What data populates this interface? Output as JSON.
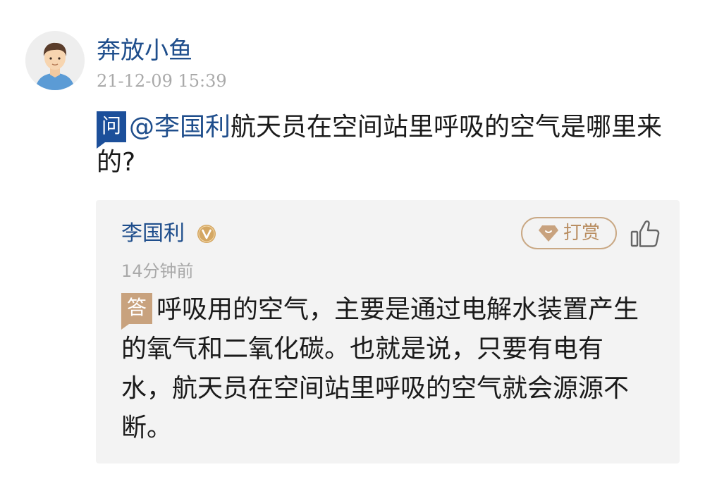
{
  "post": {
    "user_name": "奔放小鱼",
    "timestamp": "21-12-09 15:39",
    "avatar_icon": "user-avatar-icon"
  },
  "question": {
    "badge": "问",
    "mention": "@李国利",
    "text": "航天员在空间站里呼吸的空气是哪里来的?"
  },
  "answer": {
    "answerer_name": "李国利",
    "verified_icon": "verified-v-badge-icon",
    "tip_label": "打赏",
    "tip_icon": "gem-icon",
    "like_icon": "thumbs-up-icon",
    "time_ago": "14分钟前",
    "badge": "答",
    "text": "呼吸用的空气，主要是通过电解水装置产生的氧气和二氧化碳。也就是说，只要有电有水，航天员在空间站里呼吸的空气就会源源不断。"
  },
  "colors": {
    "link_blue": "#1f4e8c",
    "question_badge": "#1c4f9a",
    "answer_badge": "#c8a27e",
    "tip_accent": "#c9a884",
    "card_background": "#f3f3f3",
    "meta_gray": "#a9a9a9"
  }
}
